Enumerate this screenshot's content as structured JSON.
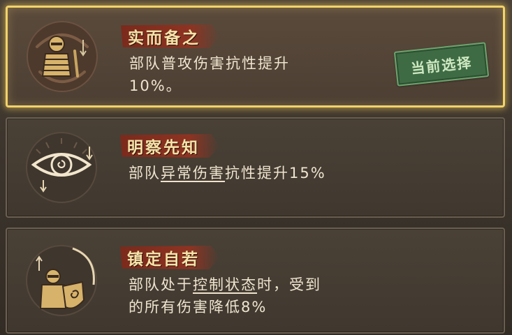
{
  "cards": [
    {
      "title": "实而备之",
      "desc_lines": [
        "部队普攻伤害抗性提升",
        "10%。"
      ],
      "selected": true,
      "badge": "当前选择",
      "icon": "armored-soldier-icon"
    },
    {
      "title": "明察先知",
      "desc_pre": "部队",
      "desc_keyword": "异常伤害",
      "desc_post": "抗性提升15%",
      "selected": false,
      "icon": "eye-icon"
    },
    {
      "title": "镇定自若",
      "desc_line1_pre": "部队处于",
      "desc_line1_keyword": "控制状态",
      "desc_line1_post": "时，受到",
      "desc_line2": "的所有伤害降低8%",
      "selected": false,
      "icon": "shield-soldier-icon"
    }
  ],
  "colors": {
    "selected_border": "#f2d36a",
    "ribbon": "#8e3322",
    "title_text": "#f6e3a8",
    "desc_text": "#efe4cf",
    "badge_bg": "#3e6b43"
  }
}
